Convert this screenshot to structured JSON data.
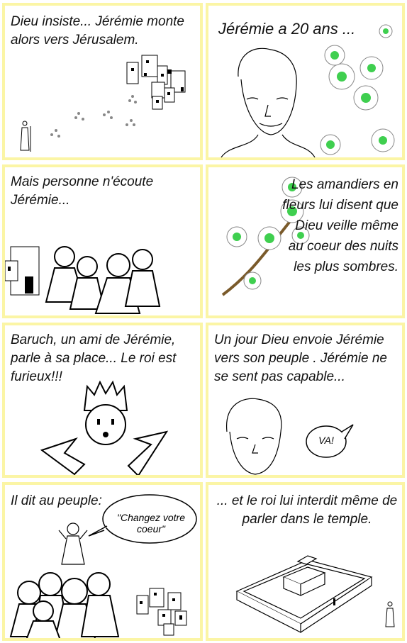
{
  "panels": [
    {
      "text": "Dieu insiste... Jérémie monte alors vers Jérusalem."
    },
    {
      "text": "Jérémie a 20 ans ..."
    },
    {
      "text": "Mais personne n'écoute Jérémie..."
    },
    {
      "text": "Les amandiers en fleurs lui disent que Dieu veille même au coeur des nuits les plus sombres."
    },
    {
      "text": "Baruch, un ami de Jérémie, parle à sa place... Le roi est furieux!!!"
    },
    {
      "text": "Un jour Dieu envoie Jérémie vers son peuple . Jérémie ne se sent pas capable...",
      "bubble": "VA!"
    },
    {
      "text": "Il dit au peuple:",
      "bubble": "\"Changez votre coeur\""
    },
    {
      "text": "... et le roi lui interdit même de parler dans le temple."
    }
  ],
  "colors": {
    "border": "#fbf5a5",
    "blossom": "#3fcf4f"
  }
}
